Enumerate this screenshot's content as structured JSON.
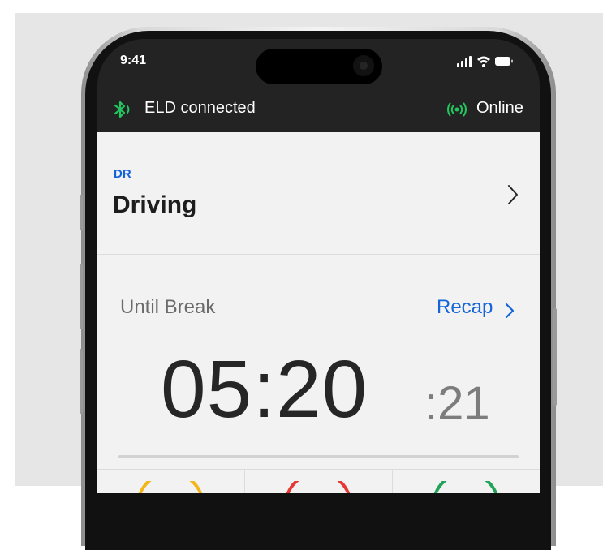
{
  "status_bar": {
    "time": "9:41"
  },
  "connection": {
    "eld_label": "ELD connected",
    "network_label": "Online",
    "accent_color": "#22c55e"
  },
  "duty_status": {
    "code": "DR",
    "title": "Driving"
  },
  "timer": {
    "label": "Until Break",
    "recap_label": "Recap",
    "main_value": "05:20",
    "seconds_value": ":21"
  },
  "gauges": [
    {
      "color": "#f2b61a"
    },
    {
      "color": "#e53935"
    },
    {
      "color": "#22a35a"
    }
  ],
  "icons": [
    "bluetooth-icon",
    "signal-bars-icon",
    "wifi-icon",
    "battery-icon",
    "online-signal-icon",
    "chevron-right-icon"
  ]
}
